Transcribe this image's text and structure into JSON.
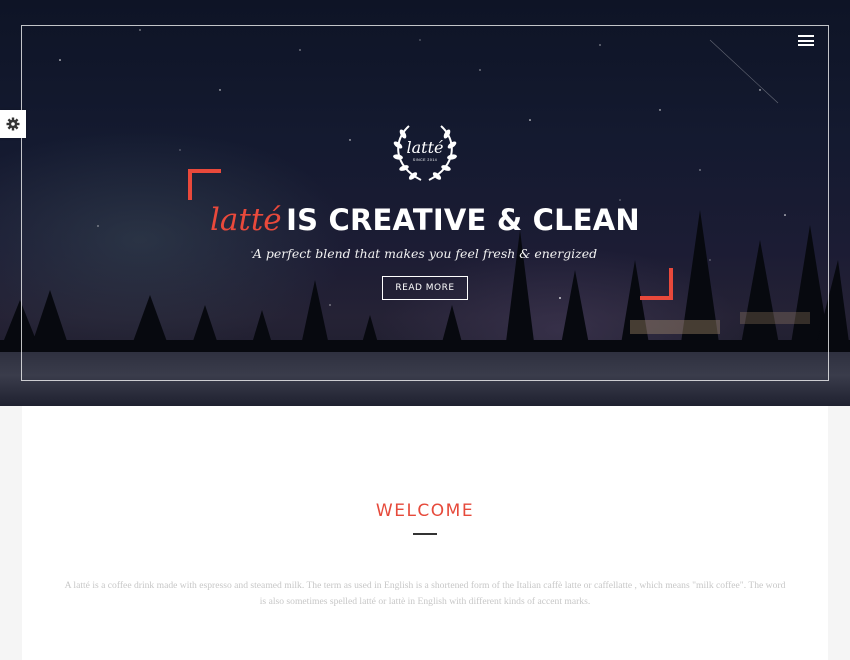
{
  "hero": {
    "logo_text": "latté",
    "logo_sub": "SINCE 2014",
    "brand": "latté",
    "headline_rest": "IS CREATIVE & CLEAN",
    "tagline": "A perfect blend that makes you feel fresh & energized",
    "cta_label": "READ MORE",
    "menu_icon": "hamburger-icon",
    "laurel_icon": "laurel-wreath-icon"
  },
  "settings": {
    "icon": "gear-icon"
  },
  "welcome": {
    "title": "WELCOME",
    "text": "A latté is a coffee drink made with espresso and steamed milk. The term as used in English is a shortened form of the Italian caffè latte or caffellatte , which means \"milk coffee\". The word is also sometimes spelled latté or lattè in English with different kinds of accent marks."
  },
  "colors": {
    "accent": "#e9493b",
    "sky_dark": "#0e1426",
    "text_muted": "#c7c7c7"
  }
}
